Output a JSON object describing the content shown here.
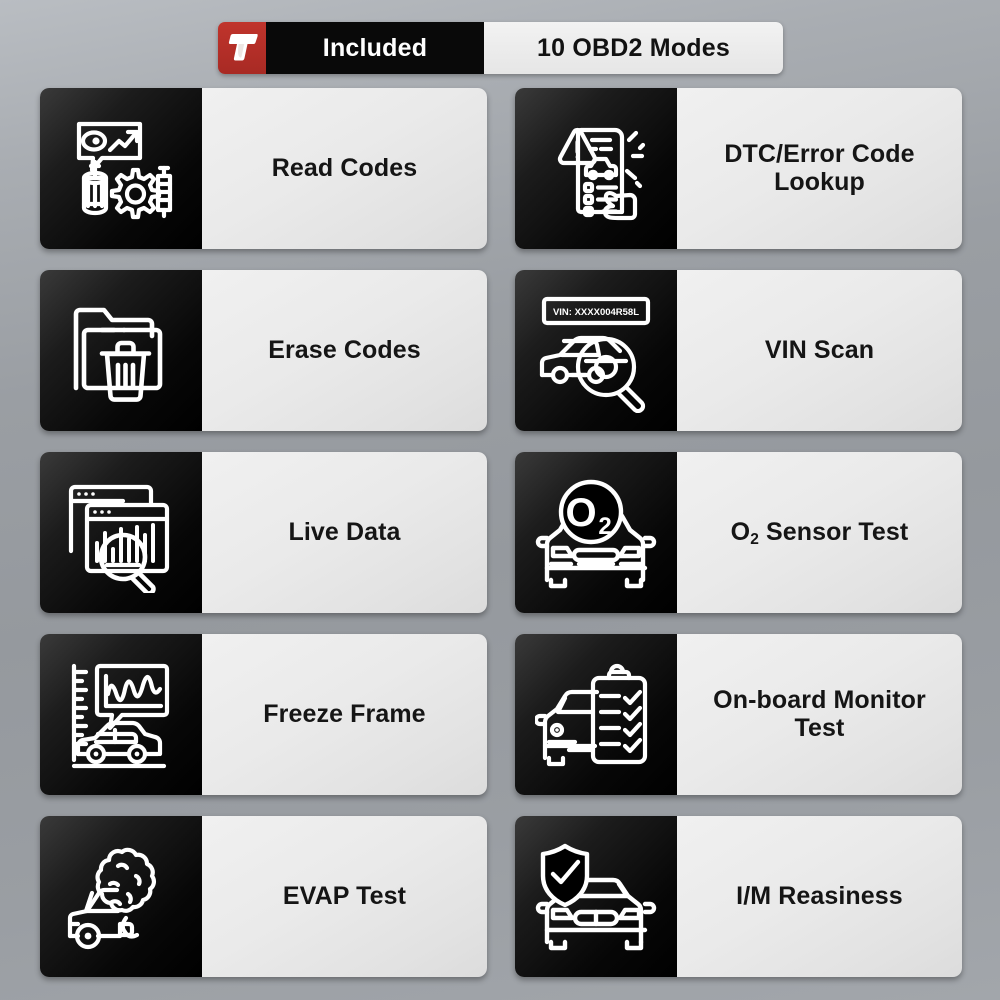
{
  "header": {
    "logo_icon": "brand-t-logo-icon",
    "left_label": "Included",
    "right_label": "10 OBD2 Modes",
    "logo_color": "#b32f28",
    "dark_color": "#090909",
    "light_color": "#eeeeee"
  },
  "cards": [
    {
      "label": "Read Codes",
      "icon": "read-codes-icon"
    },
    {
      "label": "DTC/Error Code Lookup",
      "icon": "dtc-error-code-lookup-icon"
    },
    {
      "label": "Erase Codes",
      "icon": "erase-codes-icon"
    },
    {
      "label": "VIN Scan",
      "icon": "vin-scan-icon",
      "vin_plate": "VIN: XXXX004R58L"
    },
    {
      "label": "Live Data",
      "icon": "live-data-icon"
    },
    {
      "label": "O2 Sensor Test",
      "label_main": "O",
      "label_sub": "2",
      "label_rest": " Sensor Test",
      "icon": "o2-sensor-test-icon",
      "icon_glyph": "O",
      "icon_glyph_sub": "2"
    },
    {
      "label": "Freeze Frame",
      "icon": "freeze-frame-icon"
    },
    {
      "label": "On-board Monitor Test",
      "icon": "on-board-monitor-test-icon"
    },
    {
      "label": "EVAP Test",
      "icon": "evap-test-icon"
    },
    {
      "label": "I/M Reasiness",
      "icon": "im-readiness-icon"
    }
  ],
  "colors": {
    "background_top": "#b9bdc2",
    "background_bottom": "#a2a6ab",
    "card_dark": "#000000",
    "card_light": "#eaeaea",
    "accent_red": "#b32f28"
  }
}
